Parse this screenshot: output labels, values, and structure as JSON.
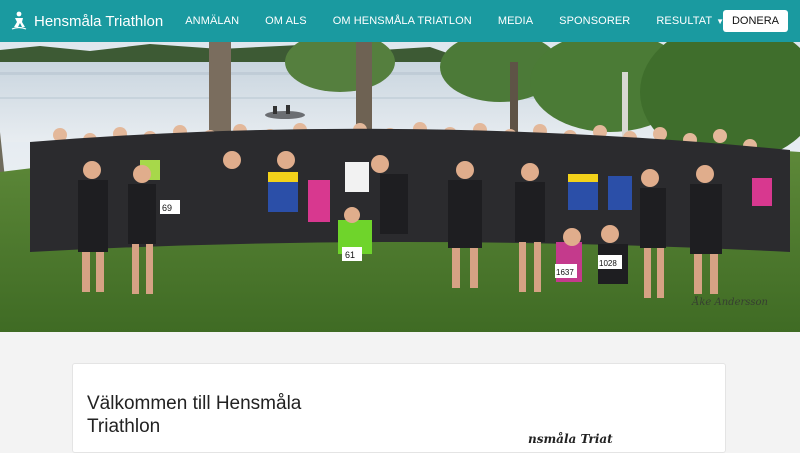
{
  "brand": {
    "name": "Hensmåla Triathlon",
    "logo_icon": "triathlete-logo-icon"
  },
  "nav": {
    "items": [
      {
        "label": "ANMÄLAN"
      },
      {
        "label": "OM ALS"
      },
      {
        "label": "OM HENSMÅLA TRIATLON"
      },
      {
        "label": "MEDIA"
      },
      {
        "label": "SPONSORER"
      },
      {
        "label": "RESULTAT",
        "dropdown": true,
        "icon": "caret-down-icon"
      }
    ],
    "donate_label": "DONERA"
  },
  "hero": {
    "photo_credit": "Åke Andersson",
    "bibs": [
      "69",
      "61",
      "1637",
      "1028"
    ]
  },
  "content": {
    "welcome_title": "Välkommen till Hensmåla Triathlon",
    "signature_text": "nsmåla Triat"
  },
  "colors": {
    "navbar": "#1a9aa0",
    "page_bg": "#f3f3f3"
  }
}
